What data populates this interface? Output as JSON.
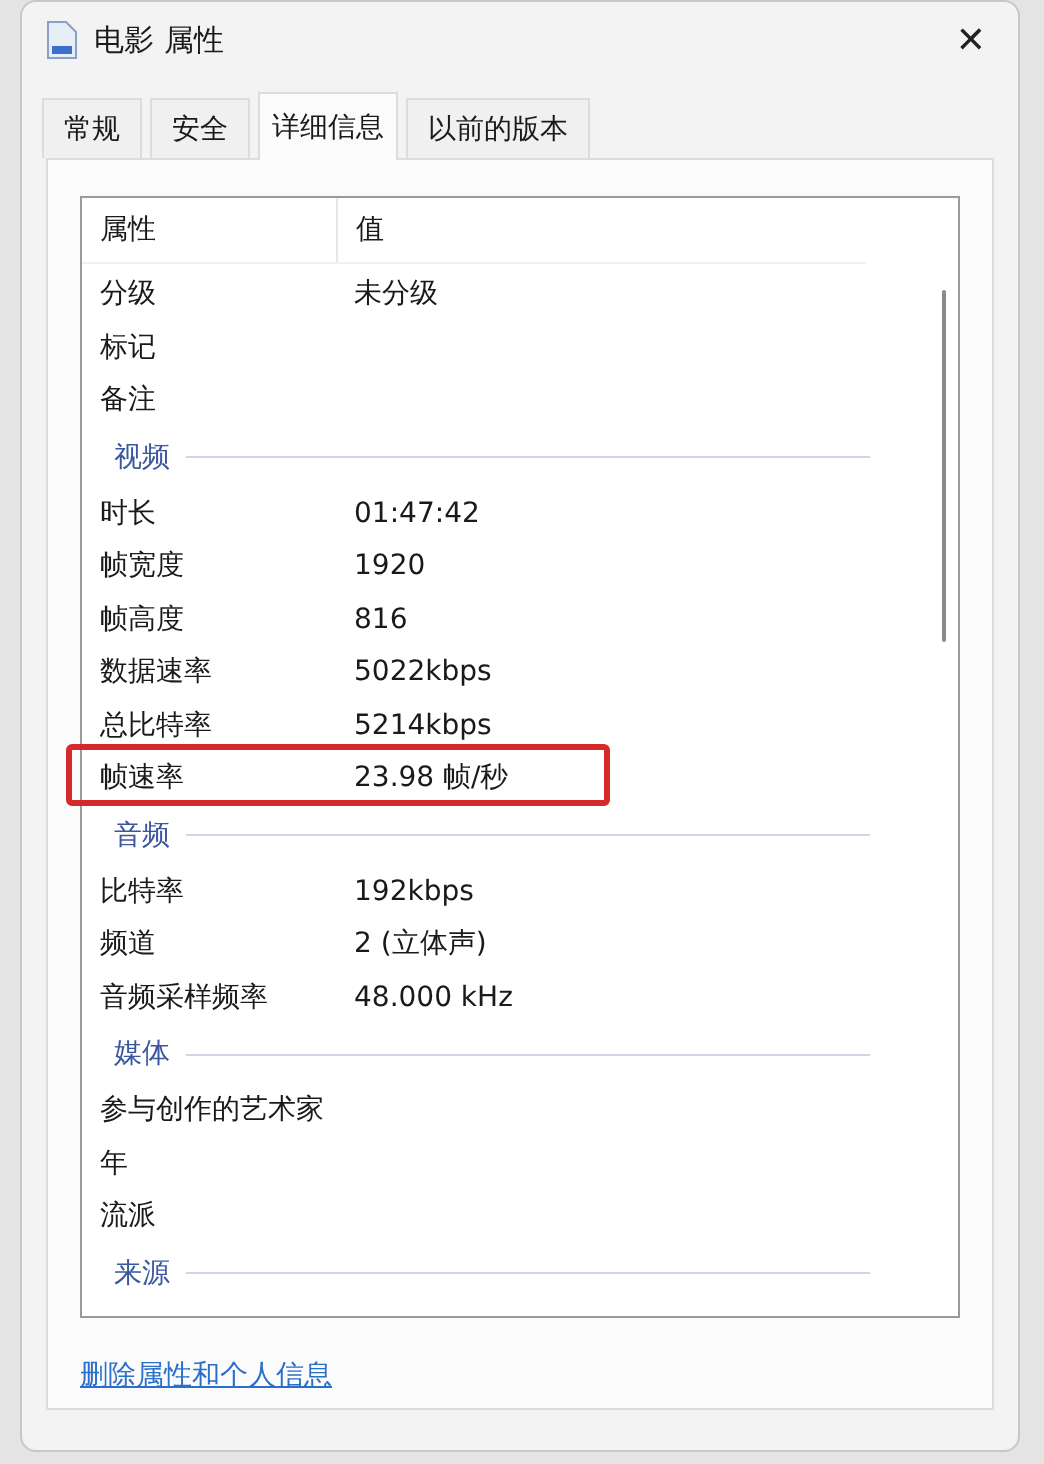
{
  "window": {
    "title": "电影 属性",
    "close": "✕"
  },
  "tabs": [
    {
      "label": "常规",
      "selected": false
    },
    {
      "label": "安全",
      "selected": false
    },
    {
      "label": "详细信息",
      "selected": true
    },
    {
      "label": "以前的版本",
      "selected": false
    }
  ],
  "table": {
    "columns": [
      "属性",
      "值"
    ],
    "rows": [
      {
        "name": "分级",
        "value": "未分级"
      },
      {
        "name": "标记"
      },
      {
        "name": "备注"
      }
    ],
    "sections": [
      {
        "title": "视频",
        "rows": [
          {
            "name": "时长",
            "value": "01:47:42"
          },
          {
            "name": "帧宽度",
            "value": "1920"
          },
          {
            "name": "帧高度",
            "value": "816"
          },
          {
            "name": "数据速率",
            "value": "5022kbps"
          },
          {
            "name": "总比特率",
            "value": "5214kbps"
          },
          {
            "name": "帧速率",
            "value": "23.98 帧/秒"
          }
        ]
      },
      {
        "title": "音频",
        "rows": [
          {
            "name": "比特率",
            "value": "192kbps"
          },
          {
            "name": "频道",
            "value": "2 (立体声)"
          },
          {
            "name": "音频采样频率",
            "value": "48.000 kHz"
          }
        ]
      },
      {
        "title": "媒体",
        "rows": [
          {
            "name": "参与创作的艺术家"
          },
          {
            "name": "年"
          },
          {
            "name": "流派"
          }
        ]
      },
      {
        "title": "来源"
      }
    ]
  },
  "link": "删除属性和个人信息"
}
